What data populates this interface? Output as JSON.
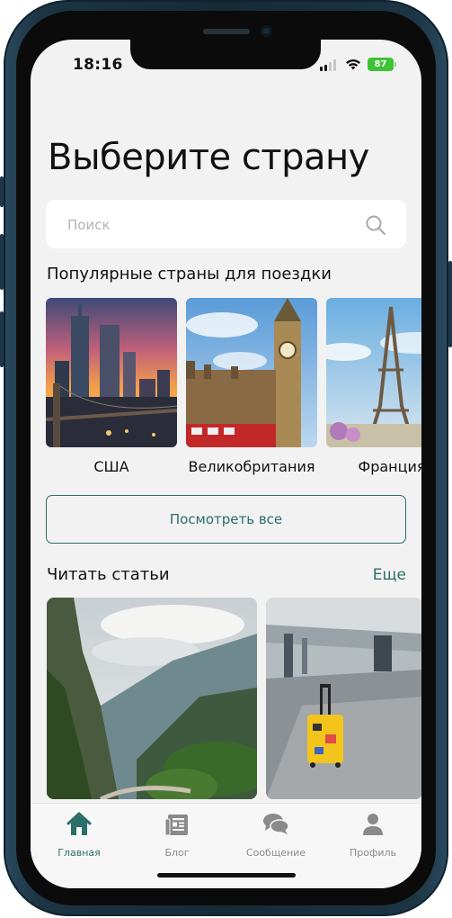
{
  "status_bar": {
    "time": "18:16",
    "battery": "87"
  },
  "header": {
    "title": "Выберите страну"
  },
  "search": {
    "placeholder": "Поиск",
    "value": ""
  },
  "popular": {
    "title": "Популярные страны для поездки",
    "countries": [
      {
        "name": "США"
      },
      {
        "name": "Великобритания"
      },
      {
        "name": "Франция"
      }
    ],
    "view_all_label": "Посмотреть все"
  },
  "articles": {
    "title": "Читать статьи",
    "more_label": "Еще"
  },
  "tabbar": {
    "tabs": [
      {
        "label": "Главная",
        "icon": "home-icon",
        "active": true
      },
      {
        "label": "Блог",
        "icon": "blog-icon",
        "active": false
      },
      {
        "label": "Сообщение",
        "icon": "message-icon",
        "active": false
      },
      {
        "label": "Профиль",
        "icon": "profile-icon",
        "active": false
      }
    ]
  },
  "colors": {
    "accent": "#2c6e68",
    "background": "#f2f2f2",
    "inactive": "#8a8a8a"
  }
}
